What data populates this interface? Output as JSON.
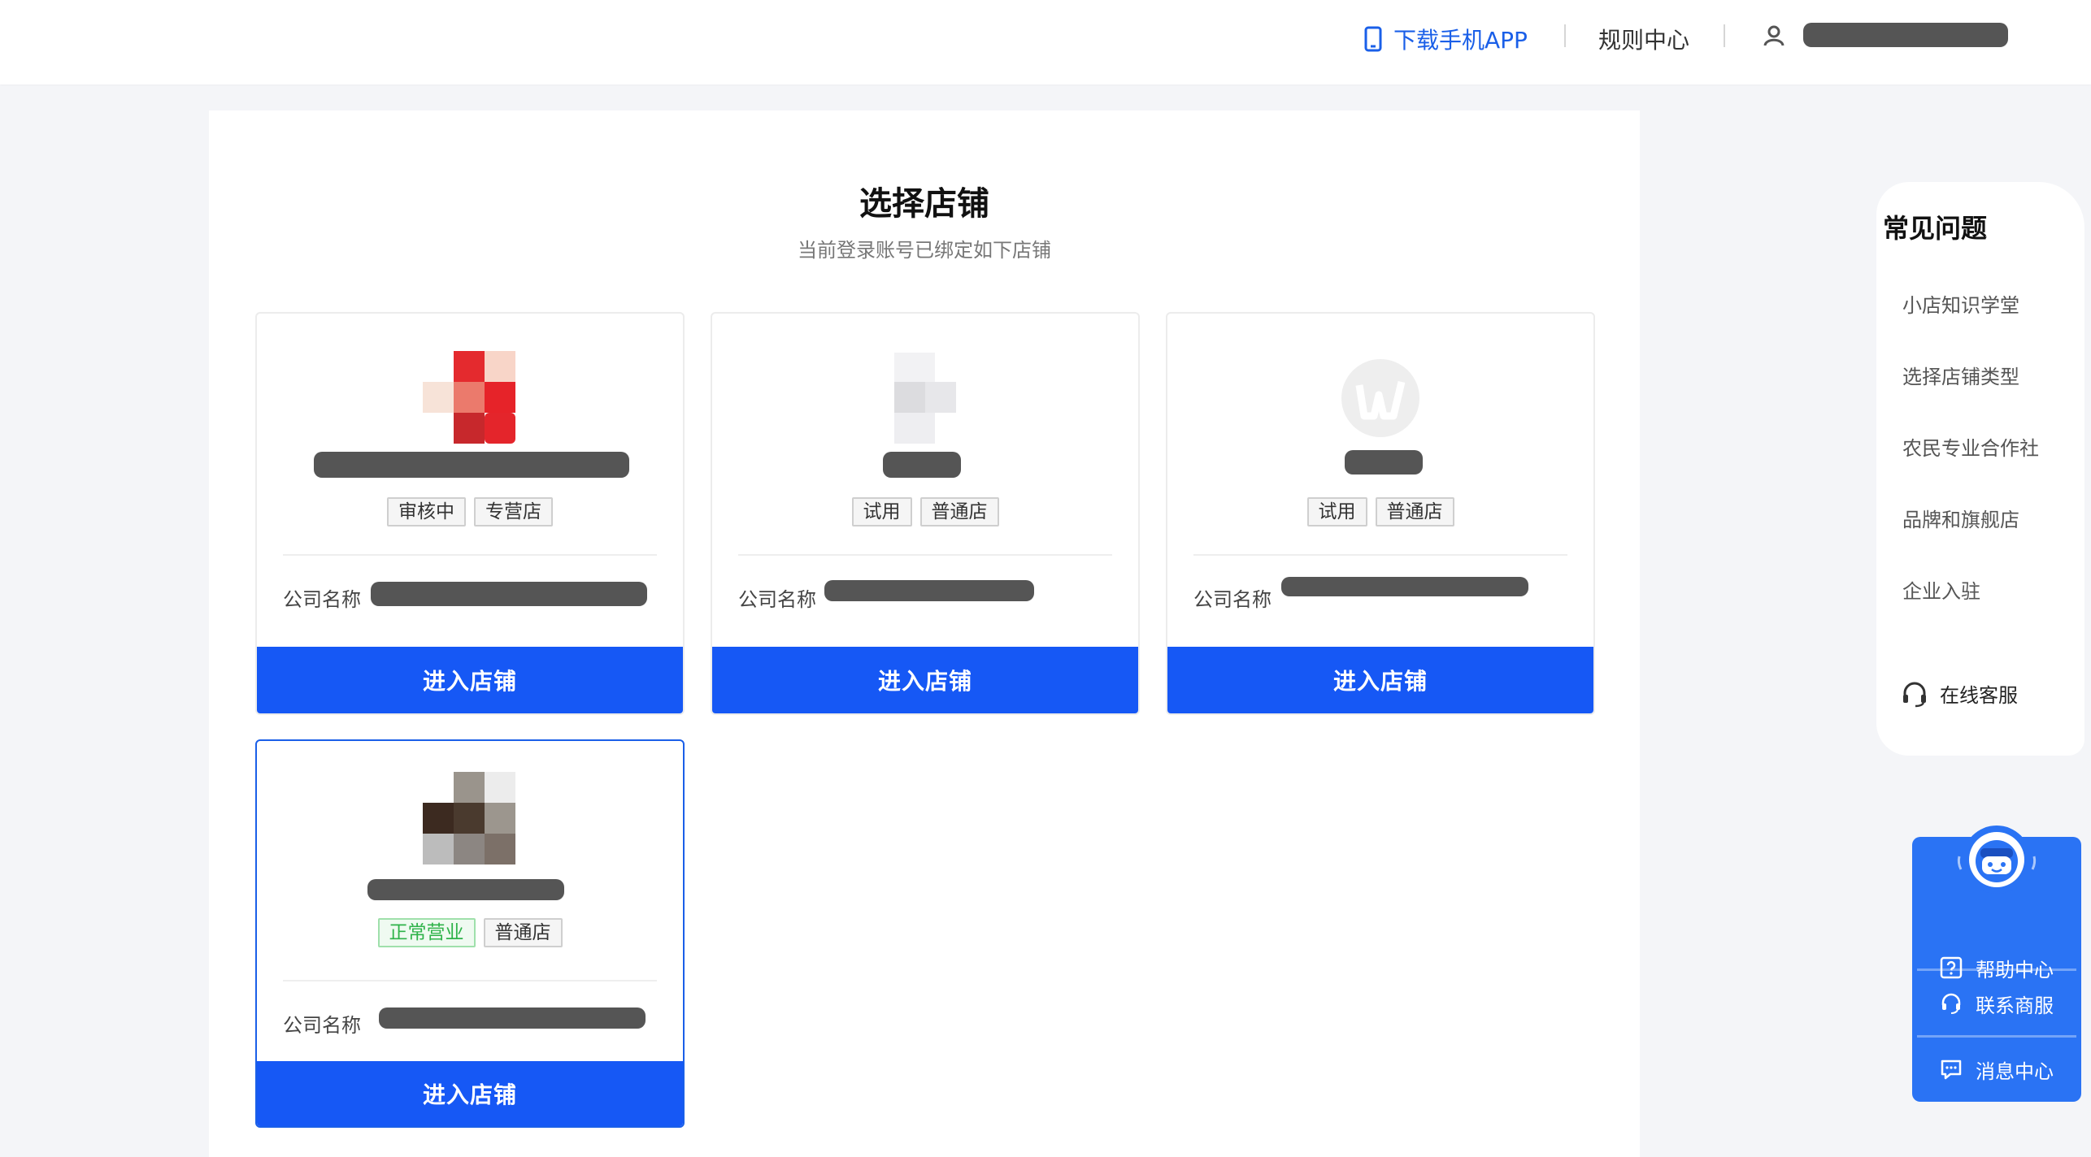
{
  "header": {
    "download_app": "下载手机APP",
    "rules_center": "规则中心"
  },
  "page": {
    "title": "选择店铺",
    "subtitle": "当前登录账号已绑定如下店铺"
  },
  "stores": [
    {
      "tags": [
        "审核中",
        "专营店"
      ],
      "company_label": "公司名称",
      "enter_label": "进入店铺"
    },
    {
      "tags": [
        "试用",
        "普通店"
      ],
      "company_label": "公司名称",
      "enter_label": "进入店铺"
    },
    {
      "tags": [
        "试用",
        "普通店"
      ],
      "company_label": "公司名称",
      "enter_label": "进入店铺"
    },
    {
      "tags": [
        "正常营业",
        "普通店"
      ],
      "company_label": "公司名称",
      "enter_label": "进入店铺"
    }
  ],
  "faq": {
    "title": "常见问题",
    "items": [
      "小店知识学堂",
      "选择店铺类型",
      "农民专业合作社",
      "品牌和旗舰店",
      "企业入驻"
    ],
    "online_service": "在线客服"
  },
  "help_widget": {
    "items": [
      "帮助中心",
      "联系商服",
      "消息中心"
    ]
  },
  "colors": {
    "primary": "#1658f5",
    "link": "#1a5fe8",
    "status_green": "#2fb34a"
  }
}
